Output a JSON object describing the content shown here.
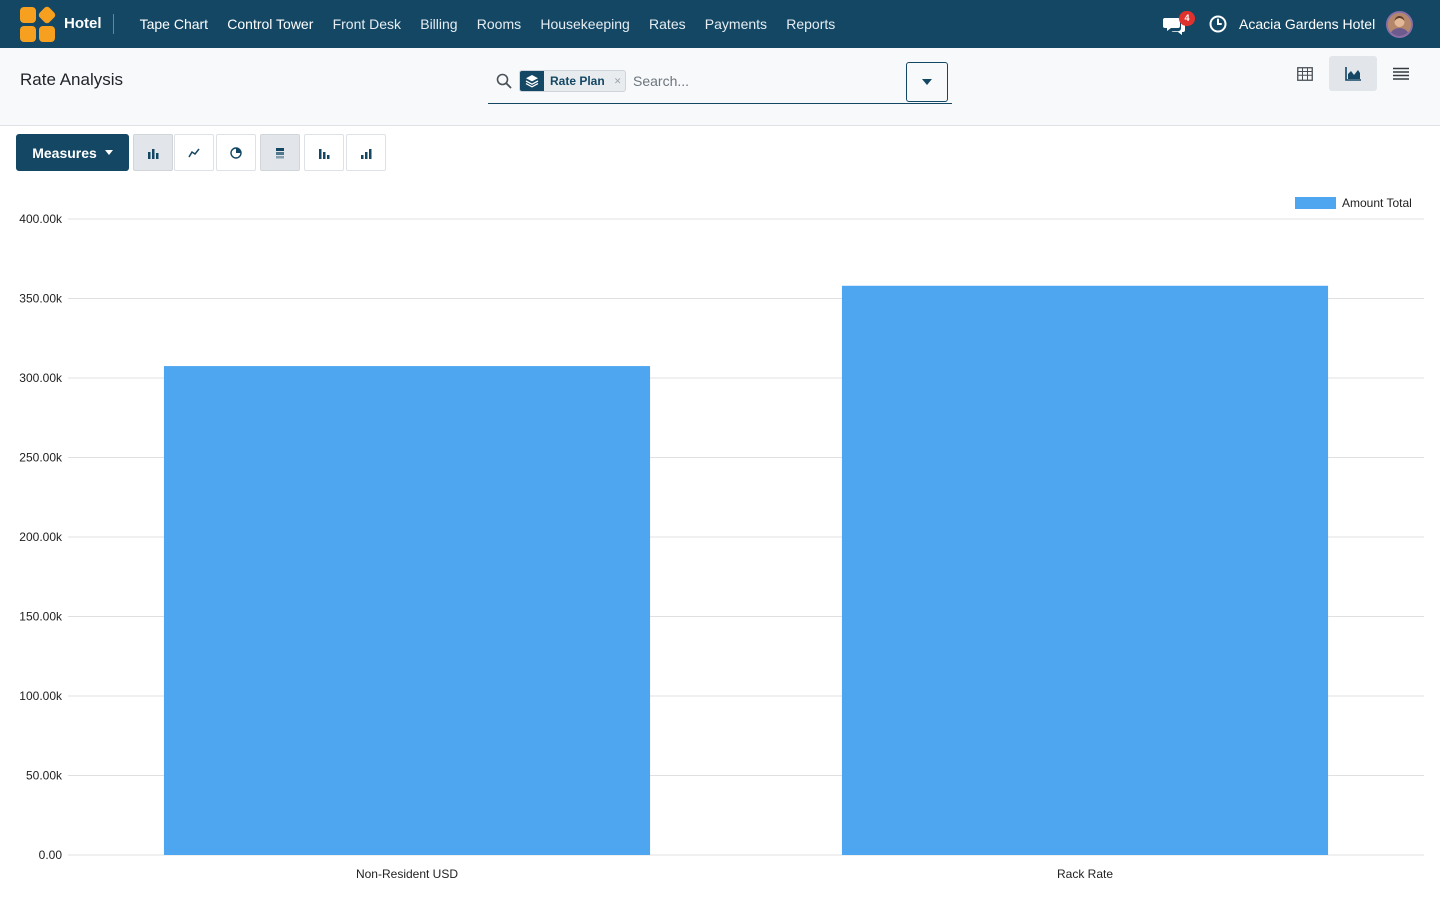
{
  "navbar": {
    "app_name": "Hotel",
    "menu": [
      "Tape Chart",
      "Control Tower",
      "Front Desk",
      "Billing",
      "Rooms",
      "Housekeeping",
      "Rates",
      "Payments",
      "Reports"
    ],
    "notification_count": "4",
    "company": "Acacia Gardens Hotel",
    "colors": {
      "bar": "#134764",
      "logo": "#f7a01f",
      "badge": "#e0322d"
    }
  },
  "control_panel": {
    "breadcrumb": "Rate Analysis",
    "search": {
      "facet_label": "Rate Plan",
      "placeholder": "Search..."
    },
    "views": [
      "pivot-view",
      "graph-view",
      "list-view"
    ],
    "active_view": "graph-view"
  },
  "toolbar": {
    "measures_label": "Measures",
    "graph_modes": [
      "bar-chart",
      "line-chart",
      "pie-chart"
    ],
    "active_mode": "bar-chart",
    "order_options": [
      "stacked",
      "descending",
      "ascending"
    ]
  },
  "chart_data": {
    "type": "bar",
    "categories": [
      "Non-Resident USD",
      "Rack Rate"
    ],
    "series": [
      {
        "name": "Amount Total",
        "values": [
          307500,
          358000
        ]
      }
    ],
    "ylim": [
      0,
      400000
    ],
    "yticks": [
      "0.00",
      "50.00k",
      "100.00k",
      "150.00k",
      "200.00k",
      "250.00k",
      "300.00k",
      "350.00k",
      "400.00k"
    ],
    "grid": true,
    "legend": "top-right",
    "color": "#4ea6f1"
  }
}
